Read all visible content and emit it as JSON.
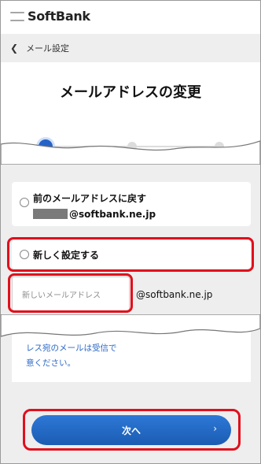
{
  "header": {
    "brand": "SoftBank"
  },
  "breadcrumb": {
    "back_icon": "chevron-left-icon",
    "label": "メール設定"
  },
  "page": {
    "title": "メールアドレスの変更"
  },
  "stepper": {
    "steps": 3,
    "current": 1,
    "accent": "#2563c9"
  },
  "options": {
    "restore_label": "前のメールアドレスに戻す",
    "restore_address_suffix": "@softbank.ne.jp",
    "new_label": "新しく設定する"
  },
  "email_input": {
    "placeholder": "新しいメールアドレス",
    "value": "",
    "domain": "@softbank.ne.jp"
  },
  "notice": {
    "line1": "レス宛のメールは受信で",
    "line2": "意ください。"
  },
  "next_button": {
    "label": "次へ",
    "icon": "chevron-right-icon"
  },
  "colors": {
    "highlight": "#e0101c",
    "button": "#1f66c2",
    "link_text": "#2a67c7"
  }
}
